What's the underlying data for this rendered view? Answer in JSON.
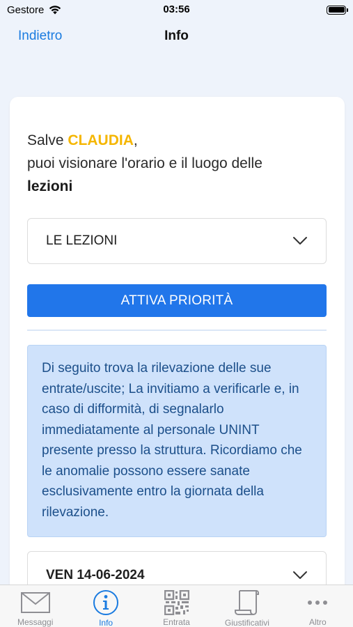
{
  "status_bar": {
    "carrier": "Gestore",
    "time": "03:56",
    "battery_level": 1.0
  },
  "nav": {
    "back_label": "Indietro",
    "title": "Info"
  },
  "greeting": {
    "salutation": "Salve",
    "user_name": "CLAUDIA",
    "comma": ",",
    "line2": "puoi visionare l'orario e il luogo delle",
    "line3_bold": "lezioni"
  },
  "lessons_select": {
    "value": "LE LEZIONI"
  },
  "priority_button": {
    "label": "ATTIVA PRIORITÀ"
  },
  "info_box": {
    "text": "Di seguito trova la rilevazione delle sue entrate/uscite; La invitiamo a verificarle e, in caso di difformità, di segnalarlo immediatamente al personale UNINT presente presso la struttura. Ricordiamo che le anomalie possono essere sanate esclusivamente entro la giornata della rilevazione."
  },
  "date_select": {
    "value": "VEN 14-06-2024"
  },
  "tabs": [
    {
      "label": "Messaggi",
      "icon": "envelope-icon",
      "active": false
    },
    {
      "label": "Info",
      "icon": "info-icon",
      "active": true
    },
    {
      "label": "Entrata",
      "icon": "qr-code-icon",
      "active": false
    },
    {
      "label": "Giustificativi",
      "icon": "document-icon",
      "active": false
    },
    {
      "label": "Altro",
      "icon": "more-icon",
      "active": false
    }
  ],
  "colors": {
    "accent_blue": "#1a7be0",
    "button_blue": "#2176ea",
    "name_yellow": "#f5b600",
    "info_bg": "#cfe2fb",
    "info_text": "#1c4f8a"
  }
}
